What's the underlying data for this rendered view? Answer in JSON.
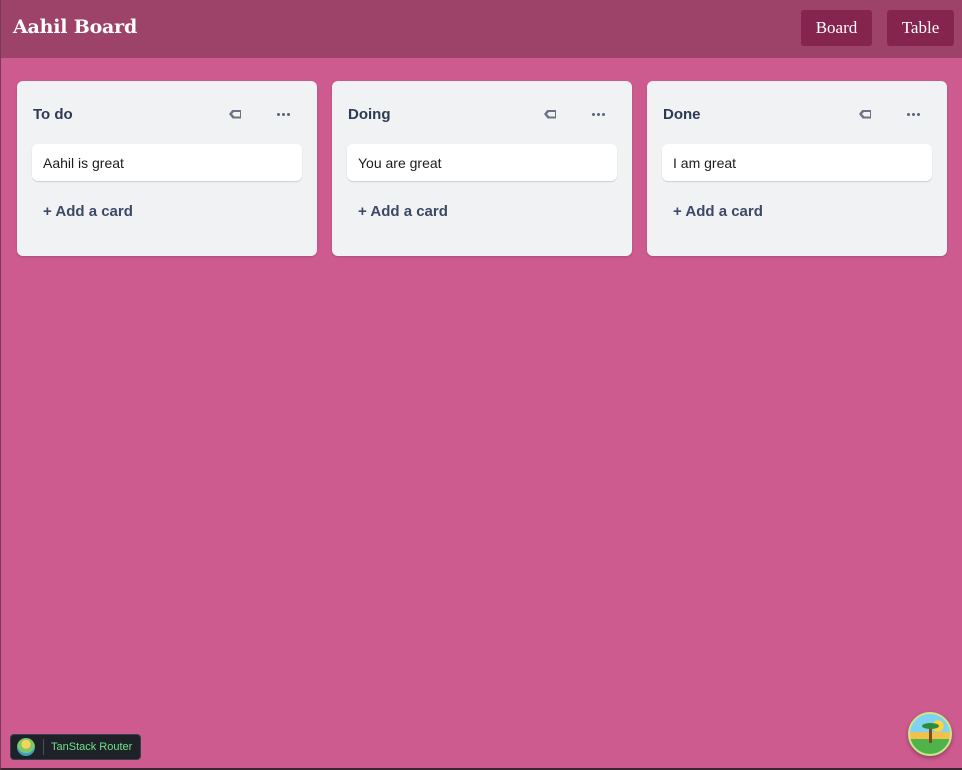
{
  "header": {
    "title": "Aahil Board",
    "nav": {
      "board_label": "Board",
      "table_label": "Table"
    }
  },
  "lists": [
    {
      "title": "To do",
      "cards": [
        "Aahil is great"
      ],
      "add_label": "+ Add a card"
    },
    {
      "title": "Doing",
      "cards": [
        "You are great"
      ],
      "add_label": "+ Add a card"
    },
    {
      "title": "Done",
      "cards": [
        "I am great"
      ],
      "add_label": "+ Add a card"
    }
  ],
  "devtools": {
    "label": "TanStack Router"
  },
  "icons": {
    "list_tag": "tag-icon",
    "list_more": "more-horizontal-icon",
    "devtools_logo": "tanstack-logo-icon",
    "fab": "island-logo-icon"
  },
  "colors": {
    "background": "#cd5b8f",
    "header": "#9d4268",
    "nav_button": "#85244e",
    "list": "#f1f2f4",
    "card": "#ffffff",
    "list_title": "#2d3a55"
  }
}
